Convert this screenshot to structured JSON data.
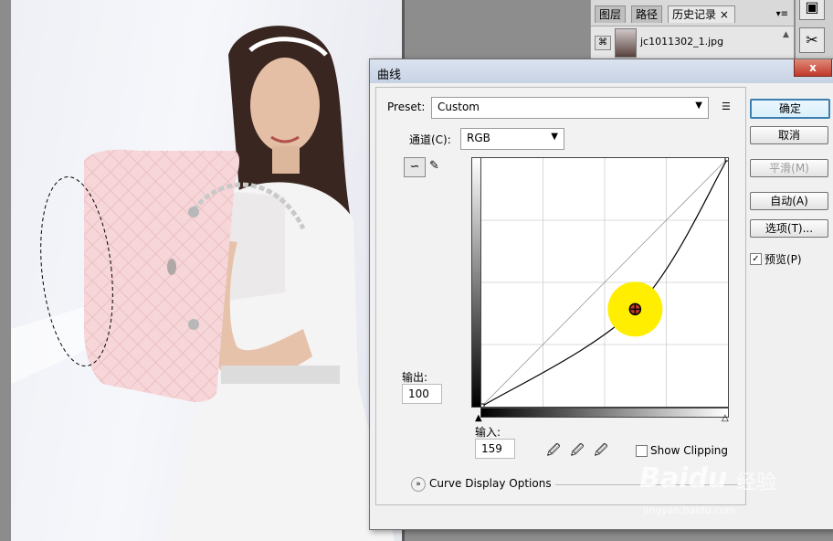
{
  "history_panel": {
    "tabs": [
      "图层",
      "路径",
      "历史记录"
    ],
    "close_glyph": "×",
    "snapshot_name": "jc1011302_1.jpg"
  },
  "dialog": {
    "title": "曲线",
    "close_glyph": "x",
    "preset_label": "Preset:",
    "preset_value": "Custom",
    "channel_label": "通道(C):",
    "channel_value": "RGB",
    "output_label": "输出:",
    "output_value": "100",
    "input_label": "输入:",
    "input_value": "159",
    "show_clipping_label": "Show Clipping",
    "curve_display_options_label": "Curve Display Options",
    "buttons": {
      "ok": "确定",
      "cancel": "取消",
      "smooth": "平滑(M)",
      "auto": "自动(A)",
      "options": "选项(T)..."
    },
    "preview_label": "预览(P)",
    "preview_checked": true
  },
  "curve": {
    "input_range": [
      0,
      255
    ],
    "output_range": [
      0,
      255
    ],
    "points": [
      [
        0,
        0
      ],
      [
        159,
        100
      ],
      [
        255,
        255
      ]
    ],
    "selected_point": [
      159,
      100
    ]
  },
  "watermark": {
    "brand": "Baidu",
    "brand_cn": "经验",
    "url": "jingyan.baidu.com"
  },
  "colors": {
    "highlight": "#ffee00",
    "title_bar": "#c7d2e5",
    "default_button_border": "#3c7fb1"
  }
}
